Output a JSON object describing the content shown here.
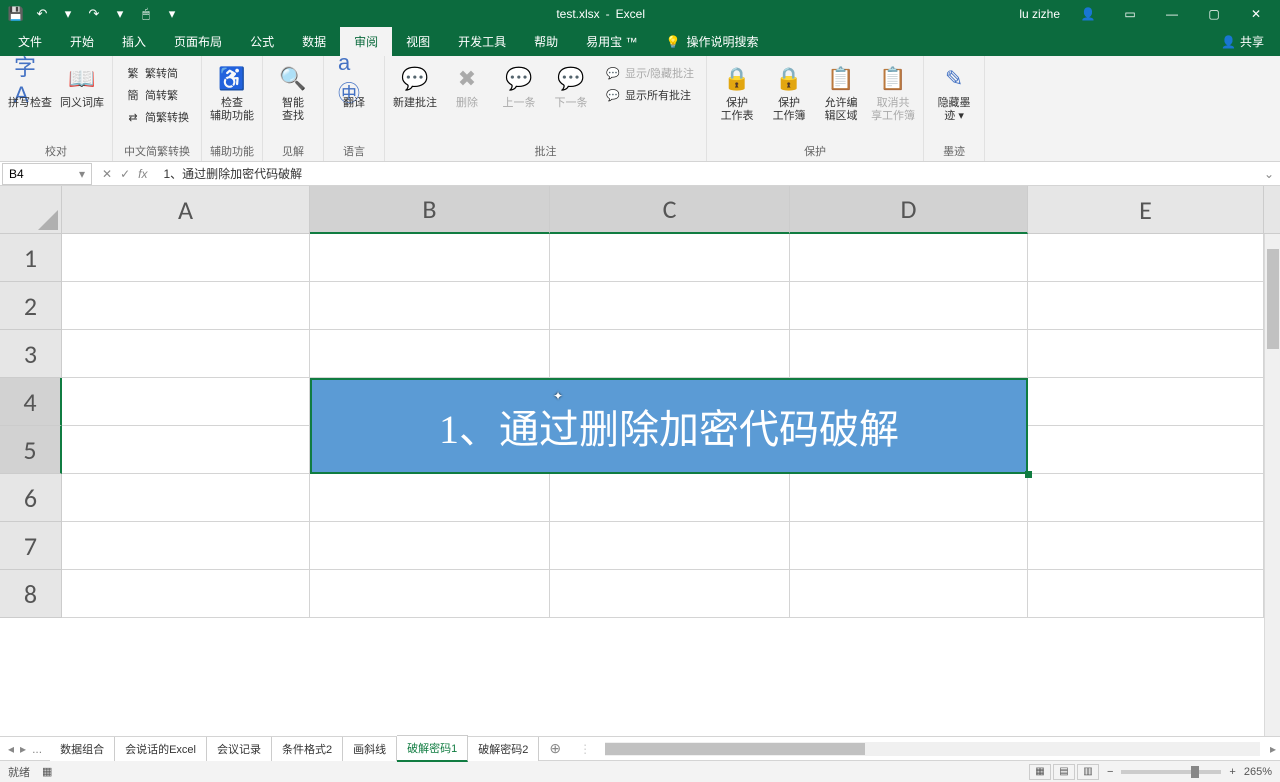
{
  "title": {
    "filename": "test.xlsx",
    "app": "Excel",
    "user": "lu zizhe"
  },
  "qat": {
    "save": "💾",
    "undo": "↶",
    "redo": "↷"
  },
  "tabs": {
    "file": "文件",
    "home": "开始",
    "insert": "插入",
    "pageLayout": "页面布局",
    "formulas": "公式",
    "data": "数据",
    "review": "审阅",
    "view": "视图",
    "developer": "开发工具",
    "help": "帮助",
    "easyuse": "易用宝 ™",
    "tellme": "操作说明搜索",
    "share": "共享"
  },
  "ribbon": {
    "proofing": {
      "label": "校对",
      "spellcheck": "拼写检查",
      "thesaurus": "同义词库"
    },
    "chinese": {
      "label": "中文简繁转换",
      "toSimple": "繁转简",
      "toTrad": "简转繁",
      "convert": "简繁转换"
    },
    "accessibility": {
      "label": "辅助功能",
      "check1": "检查",
      "check2": "辅助功能"
    },
    "insights": {
      "label": "见解",
      "smart1": "智能",
      "smart2": "查找"
    },
    "language": {
      "label": "语言",
      "translate": "翻译"
    },
    "comments": {
      "label": "批注",
      "new": "新建批注",
      "delete": "删除",
      "prev": "上一条",
      "next": "下一条",
      "showHide": "显示/隐藏批注",
      "showAll": "显示所有批注"
    },
    "protect": {
      "label": "保护",
      "sheet1": "保护",
      "sheet2": "工作表",
      "workbook1": "保护",
      "workbook2": "工作簿",
      "allow1": "允许编",
      "allow2": "辑区域",
      "unshare1": "取消共",
      "unshare2": "享工作簿"
    },
    "ink": {
      "label": "墨迹",
      "hide1": "隐藏墨",
      "hide2": "迹 ▾"
    }
  },
  "formulaBar": {
    "nameBox": "B4",
    "formula": "1、通过删除加密代码破解"
  },
  "grid": {
    "colWidths": {
      "A": 248,
      "B": 240,
      "C": 240,
      "D": 238,
      "E": 236
    },
    "columns": [
      "A",
      "B",
      "C",
      "D",
      "E"
    ],
    "rows": [
      "1",
      "2",
      "3",
      "4",
      "5",
      "6",
      "7",
      "8"
    ],
    "mergedCell": {
      "text": "1、通过删除加密代码破解"
    },
    "selectedCols": [
      "B",
      "C",
      "D"
    ],
    "selectedRows": [
      "4",
      "5"
    ]
  },
  "sheets": {
    "list": [
      "数据组合",
      "会说话的Excel",
      "会议记录",
      "条件格式2",
      "画斜线",
      "破解密码1",
      "破解密码2"
    ],
    "active": "破解密码1",
    "ellipsis": "..."
  },
  "status": {
    "ready": "就绪",
    "zoom": "265%"
  }
}
